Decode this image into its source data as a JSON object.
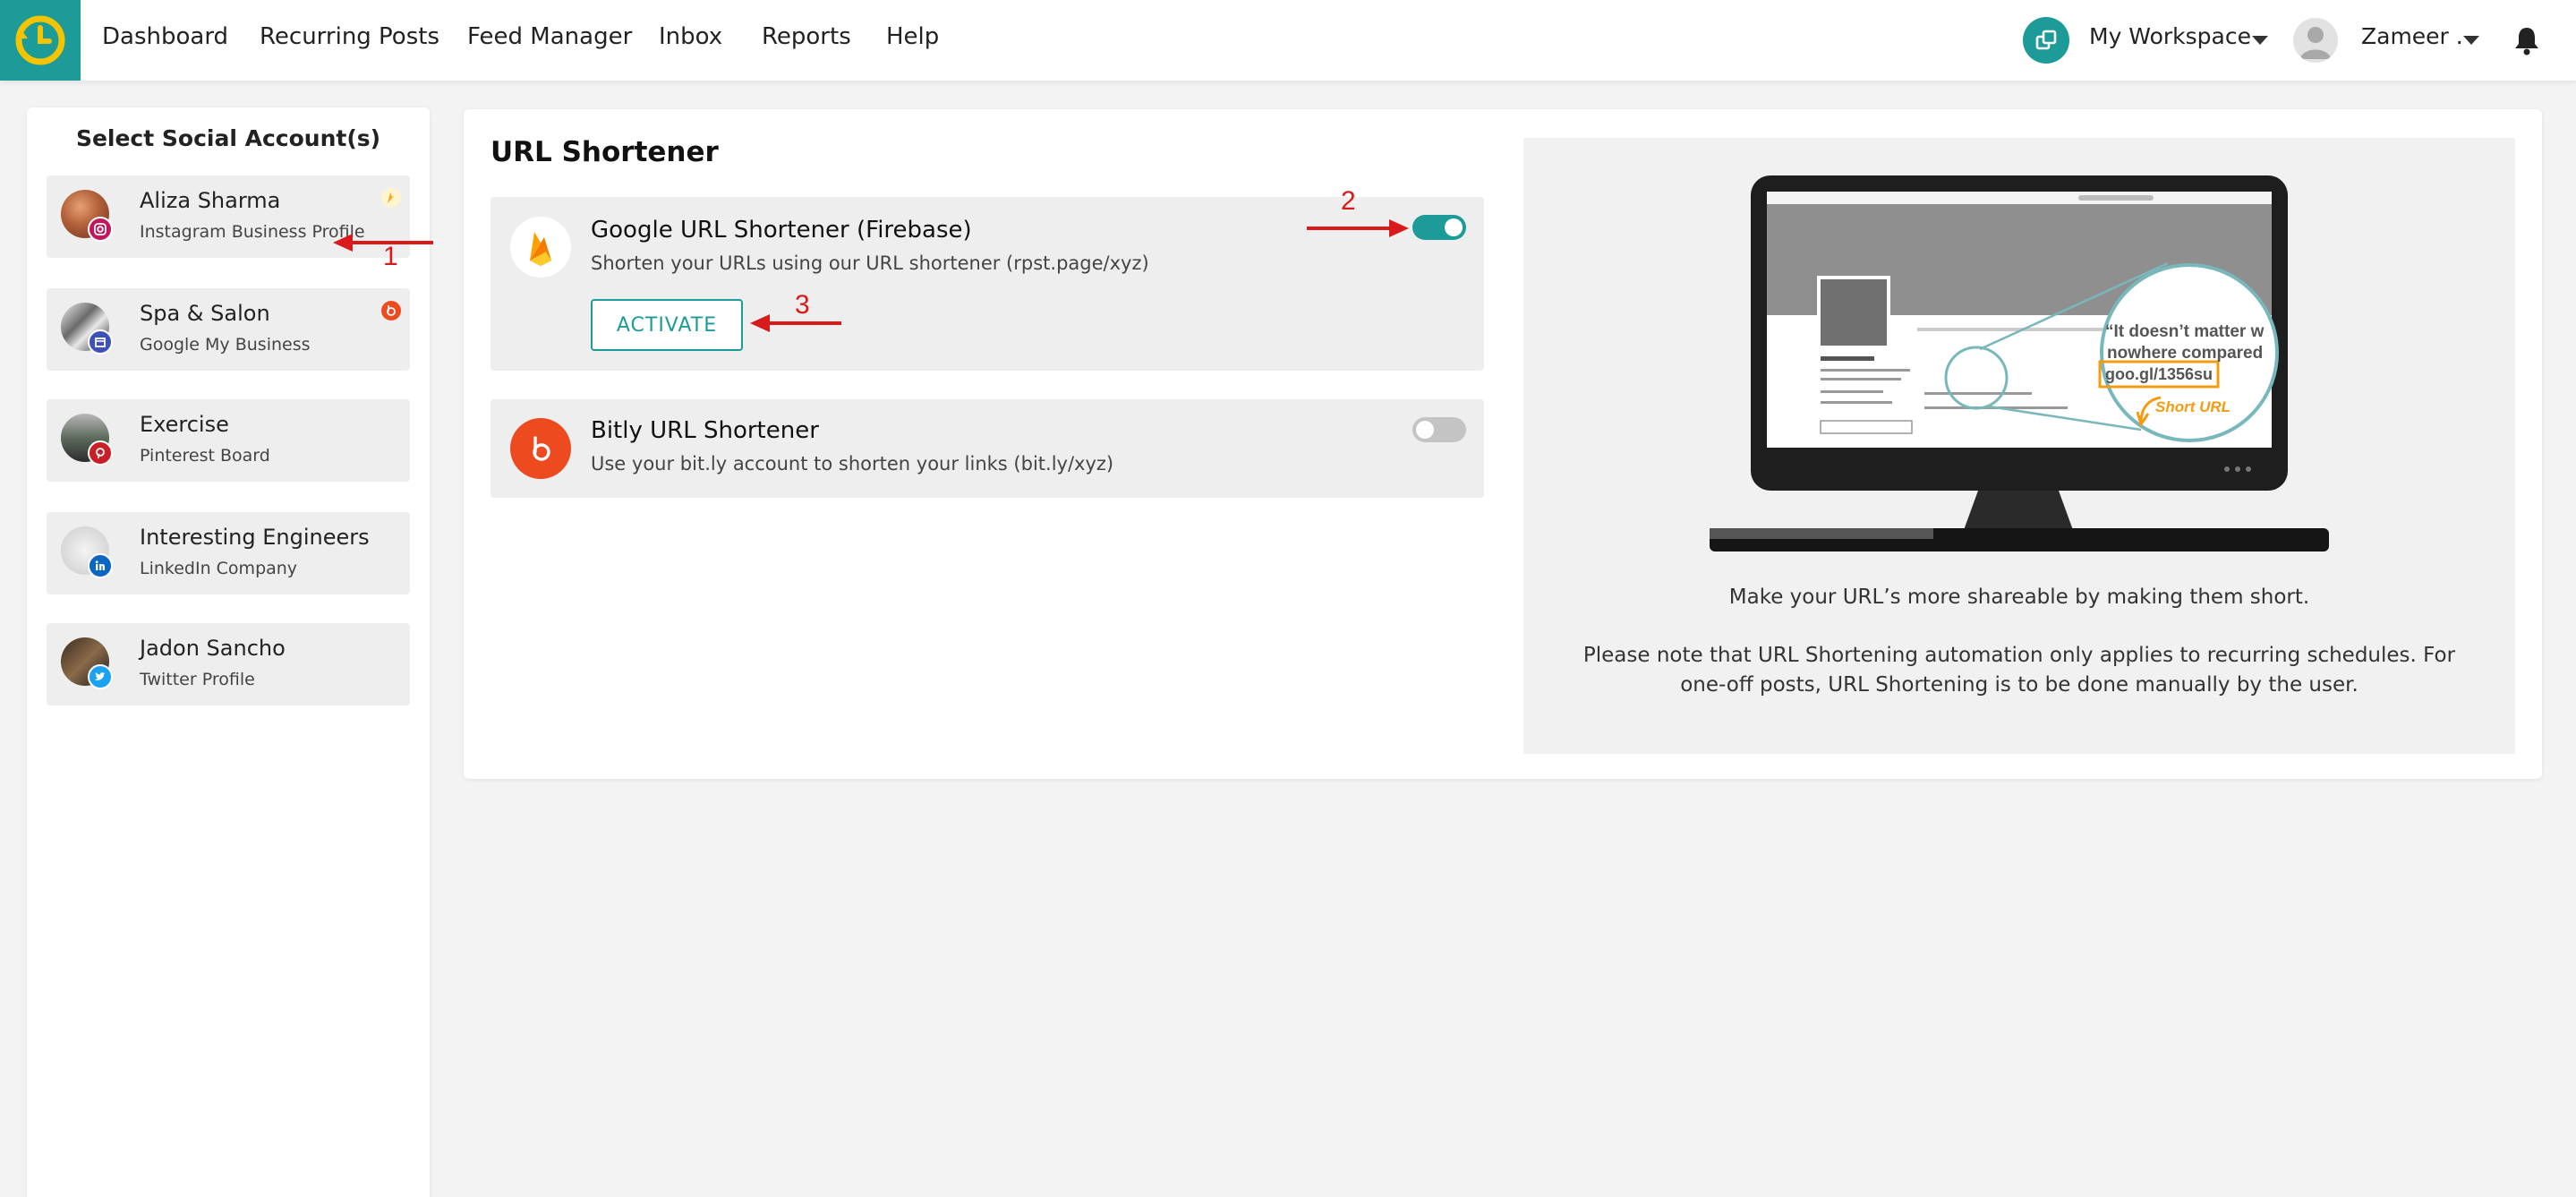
{
  "nav": {
    "items": [
      "Dashboard",
      "Recurring Posts",
      "Feed Manager",
      "Inbox",
      "Reports",
      "Help"
    ],
    "workspace_label": "My Workspace",
    "user_label": "Zameer ."
  },
  "sidebar": {
    "title": "Select Social Account(s)",
    "accounts": [
      {
        "name": "Aliza Sharma",
        "type": "Instagram Business Profile",
        "network_icon": "instagram-icon",
        "network_color": "#c2185b"
      },
      {
        "name": "Spa & Salon",
        "type": "Google My Business",
        "network_icon": "google-my-business-icon",
        "network_color": "#3f51b5"
      },
      {
        "name": "Exercise",
        "type": "Pinterest Board",
        "network_icon": "pinterest-icon",
        "network_color": "#cb1f27"
      },
      {
        "name": "Interesting Engineers",
        "type": "LinkedIn Company",
        "network_icon": "linkedin-icon",
        "network_color": "#0a66c2"
      },
      {
        "name": "Jadon Sancho",
        "type": "Twitter Profile",
        "network_icon": "twitter-icon",
        "network_color": "#1da1f2"
      }
    ]
  },
  "main": {
    "title": "URL Shortener",
    "services": [
      {
        "name": "Google URL Shortener (Firebase)",
        "description": "Shorten your URLs using our URL shortener (rpst.page/xyz)",
        "enabled": true,
        "icon": "firebase-icon",
        "action_label": "ACTIVATE"
      },
      {
        "name": "Bitly URL Shortener",
        "description": "Use your bit.ly account to shorten your links (bit.ly/xyz)",
        "enabled": false,
        "icon": "bitly-icon"
      }
    ],
    "preview": {
      "quote_line1": "“It doesn’t matter w",
      "quote_line2": "nowhere compared",
      "short_link": "goo.gl/1356su",
      "short_url_label": "Short URL",
      "text1": "Make your URL’s more shareable by making them short.",
      "text2": "Please note that URL Shortening automation only applies to recurring schedules. For one-off posts, URL Shortening is to be done manually by the user."
    }
  },
  "annotations": [
    "1",
    "2",
    "3"
  ],
  "colors": {
    "accent": "#1d9b98",
    "annotation": "#d91a1a",
    "logo_clock": "#f5c400"
  }
}
